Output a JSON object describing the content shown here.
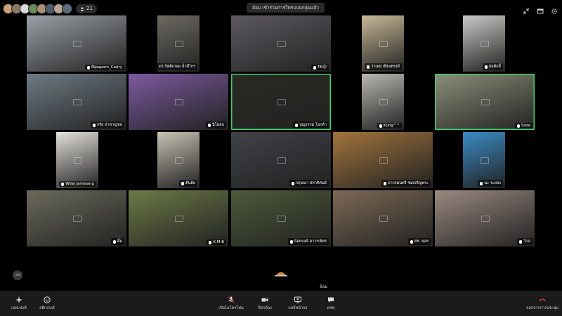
{
  "participants_count": "21",
  "banner": "ล้อม  เข้าร่วมการโทรแบบกลุ่มแล้ว",
  "self_name": "ล้อม",
  "tiles": [
    {
      "name": "Nipaporn_Cadry",
      "bg": "#9aa0a6",
      "speaking": false
    },
    {
      "name": "ดร.กิตติเกษม ย่ำดีไกร",
      "bg": "#6d6a62",
      "speaking": false
    },
    {
      "name": "PK😊",
      "bg": "#5c5a60",
      "speaking": false
    },
    {
      "name": "ว่าเพย เทียงตรงดี",
      "bg": "#c7b897",
      "speaking": false
    },
    {
      "name": "สมศักดิ์",
      "bg": "#c9c9c7",
      "speaking": false
    },
    {
      "name": "จรัย ปาทาญชล",
      "bg": "#6f7b84",
      "speaking": false
    },
    {
      "name": "นีโดยบ",
      "bg": "#7d5aa0",
      "speaking": false
    },
    {
      "name": "บุญธรรม โยกล้า",
      "bg": "#2a2a24",
      "speaking": true
    },
    {
      "name": "Kung^^",
      "bg": "#b8b7b0",
      "speaking": false
    },
    {
      "name": "Saza",
      "bg": "#8c8f7a",
      "speaking": true
    },
    {
      "name": "Wilai Jamjeang",
      "bg": "#e4e2dc",
      "speaking": false
    },
    {
      "name": "ต้นอ้อ",
      "bg": "#c9c2b4",
      "speaking": false
    },
    {
      "name": "กฤษณา สหาดิศนย์",
      "bg": "#3f4247",
      "speaking": false
    },
    {
      "name": "ถาวรมนตรี ชมเจริญพระ",
      "bg": "#a2743c",
      "speaking": false
    },
    {
      "name": "นะ ระยอง",
      "bg": "#3a8cc6",
      "speaking": false
    },
    {
      "name": "ดิ๋ม",
      "bg": "#6b6a5c",
      "speaking": false
    },
    {
      "name": "K.M.B",
      "bg": "#6c7a46",
      "speaking": false
    },
    {
      "name": "น้อยบงค์ ดาวรเพียร",
      "bg": "#4d5a3a",
      "speaking": false
    },
    {
      "name": "สท. นอร",
      "bg": "#7d6a56",
      "speaking": false
    },
    {
      "name": "โกล",
      "bg": "#9a8a80",
      "speaking": false
    }
  ],
  "controls": {
    "left": [
      {
        "label": "เอฟเฟกต์",
        "icon": "effects-icon"
      },
      {
        "label": "สติกเกอร์",
        "icon": "sticker-icon"
      }
    ],
    "center": [
      {
        "label": "เปิดไมโครโฟน",
        "icon": "mic-icon"
      },
      {
        "label": "ปิดกล้อง",
        "icon": "camera-icon"
      },
      {
        "label": "แชร์หน้าจอ",
        "icon": "share-screen-icon"
      },
      {
        "label": "แชท",
        "icon": "chat-icon"
      }
    ],
    "leave": {
      "label": "ออกจากการประชุม",
      "icon": "hangup-icon"
    }
  },
  "colors": {
    "speaking_border": "#3ed26a",
    "hangup": "#e53935",
    "bar": "#1b1b1b"
  }
}
